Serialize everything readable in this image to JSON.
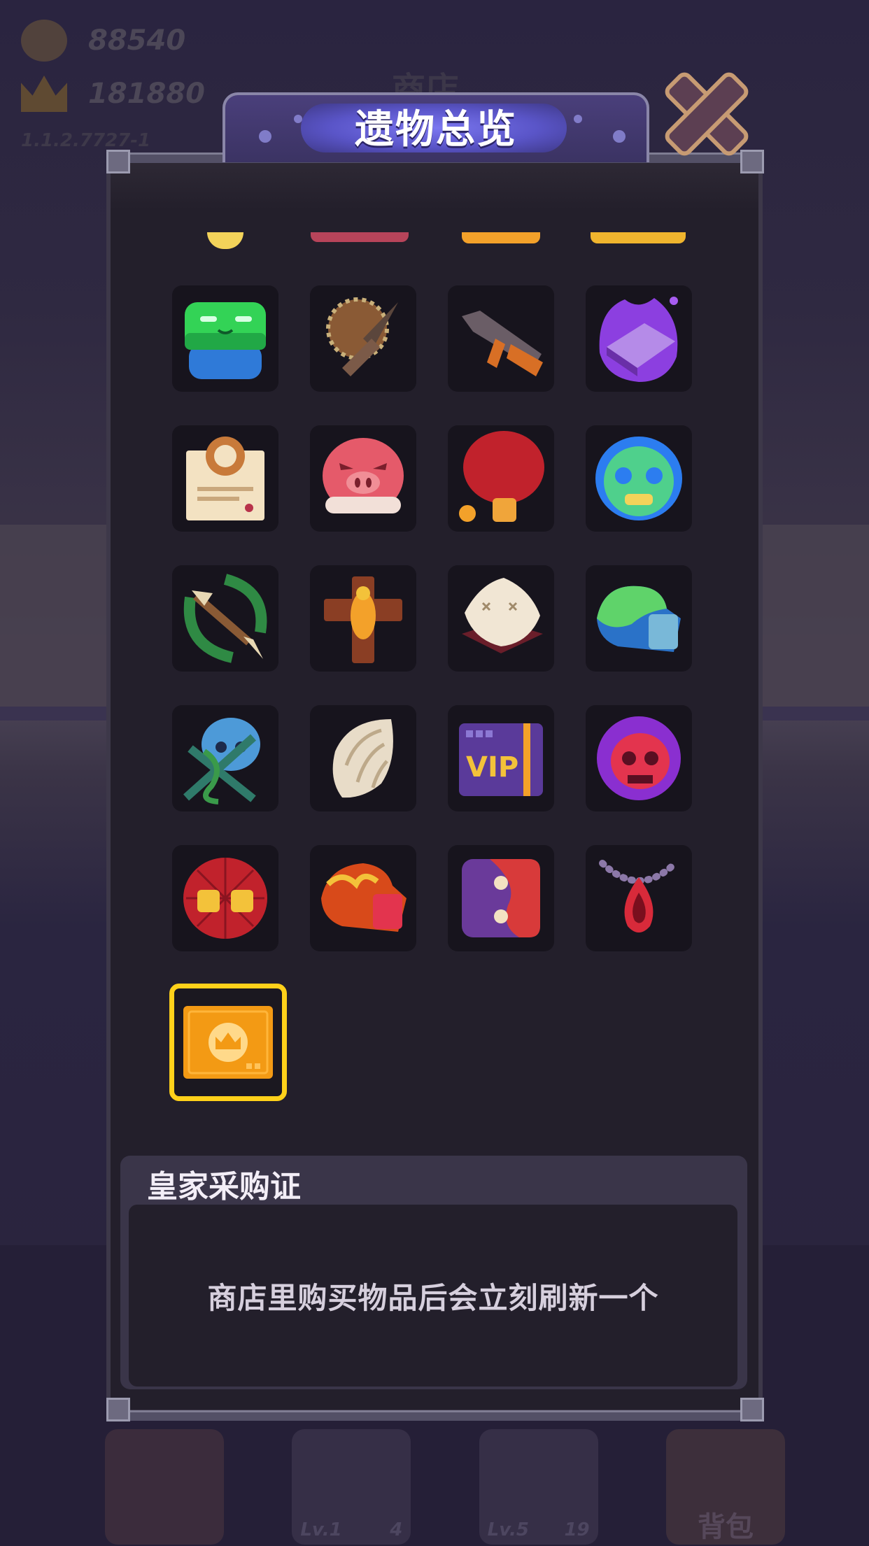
{
  "hud": {
    "coins": "88540",
    "trophies": "181880",
    "version": "1.1.2.7727-1",
    "shop_title": "商店"
  },
  "bottom_bar": {
    "items": [
      {
        "level": "Lv.1",
        "count": "4"
      },
      {
        "level": "Lv.5",
        "count": "19"
      }
    ],
    "bag_label": "背包"
  },
  "modal": {
    "title": "遗物总览",
    "close_icon": "close-x-icon"
  },
  "relics": [
    {
      "name": "green-frog-relic",
      "row": 1,
      "col": 0
    },
    {
      "name": "spiked-shield-spear-relic",
      "row": 1,
      "col": 1
    },
    {
      "name": "rifle-relic",
      "row": 1,
      "col": 2
    },
    {
      "name": "cursed-book-relic",
      "row": 1,
      "col": 3
    },
    {
      "name": "certificate-relic",
      "row": 2,
      "col": 0
    },
    {
      "name": "pig-face-relic",
      "row": 2,
      "col": 1
    },
    {
      "name": "ping-pong-paddle-relic",
      "row": 2,
      "col": 2
    },
    {
      "name": "luchador-mask-relic",
      "row": 2,
      "col": 3
    },
    {
      "name": "bow-arrow-relic",
      "row": 3,
      "col": 0
    },
    {
      "name": "golden-cross-relic",
      "row": 3,
      "col": 1
    },
    {
      "name": "pillow-relic",
      "row": 3,
      "col": 2
    },
    {
      "name": "slime-glove-relic",
      "row": 3,
      "col": 3
    },
    {
      "name": "vine-skull-relic",
      "row": 4,
      "col": 0
    },
    {
      "name": "angel-wing-relic",
      "row": 4,
      "col": 1
    },
    {
      "name": "vip-card-relic",
      "row": 4,
      "col": 2,
      "text": "VIP"
    },
    {
      "name": "reaper-skull-relic",
      "row": 4,
      "col": 3
    },
    {
      "name": "spider-mask-relic",
      "row": 5,
      "col": 0
    },
    {
      "name": "flame-glove-relic",
      "row": 5,
      "col": 1
    },
    {
      "name": "yin-yang-dice-relic",
      "row": 5,
      "col": 2
    },
    {
      "name": "blood-drop-necklace-relic",
      "row": 5,
      "col": 3
    },
    {
      "name": "royal-purchase-card-relic",
      "row": 6,
      "col": 0,
      "selected": true
    }
  ],
  "selected_relic": {
    "name": "皇家采购证",
    "description": "商店里购买物品后会立刻刷新一个"
  },
  "colors": {
    "selected_border": "#ffd11a",
    "panel_bg": "#231f2b",
    "title_glow": "#7b77f0"
  }
}
